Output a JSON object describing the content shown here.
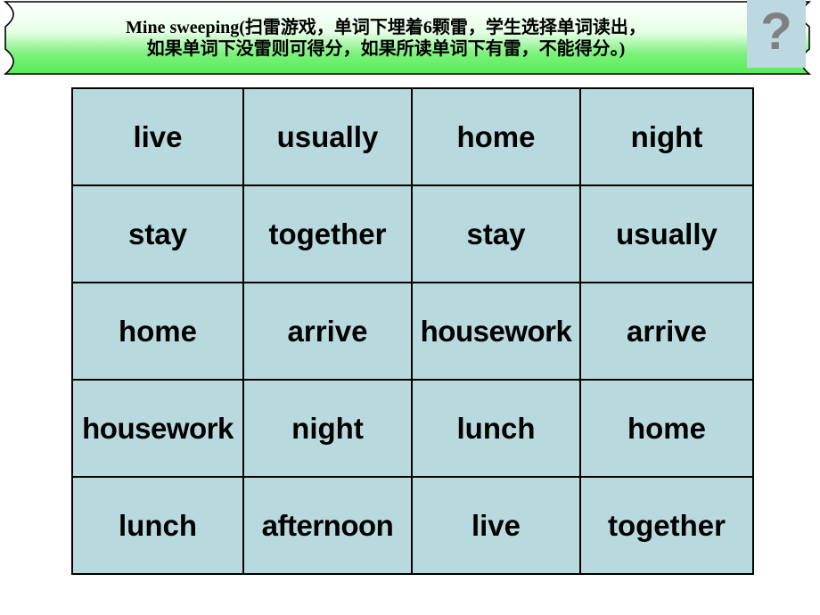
{
  "banner": {
    "title_line_1": "Mine sweeping(扫雷游戏，单词下埋着6颗雷，学生选择单词读出，",
    "title_line_2": "如果单词下没雷则可得分，如果所读单词下有雷，不能得分。)",
    "gradient_top_color": "#ffffff",
    "gradient_bottom_color": "#5bee5b",
    "outline_color": "#000000"
  },
  "help_badge": {
    "glyph": "?",
    "background_color": "#bcd9e2",
    "glyph_color": "#808080"
  },
  "grid": {
    "cell_background": "#b8dade",
    "border_color": "#000000",
    "columns": 4,
    "rows_count": 5,
    "rows": [
      [
        "live",
        "usually",
        "home",
        "night"
      ],
      [
        "stay",
        "together",
        "stay",
        "usually"
      ],
      [
        "home",
        "arrive",
        "housework",
        "arrive"
      ],
      [
        "housework",
        "night",
        "lunch",
        "home"
      ],
      [
        "lunch",
        "afternoon",
        "live",
        "together"
      ]
    ]
  }
}
